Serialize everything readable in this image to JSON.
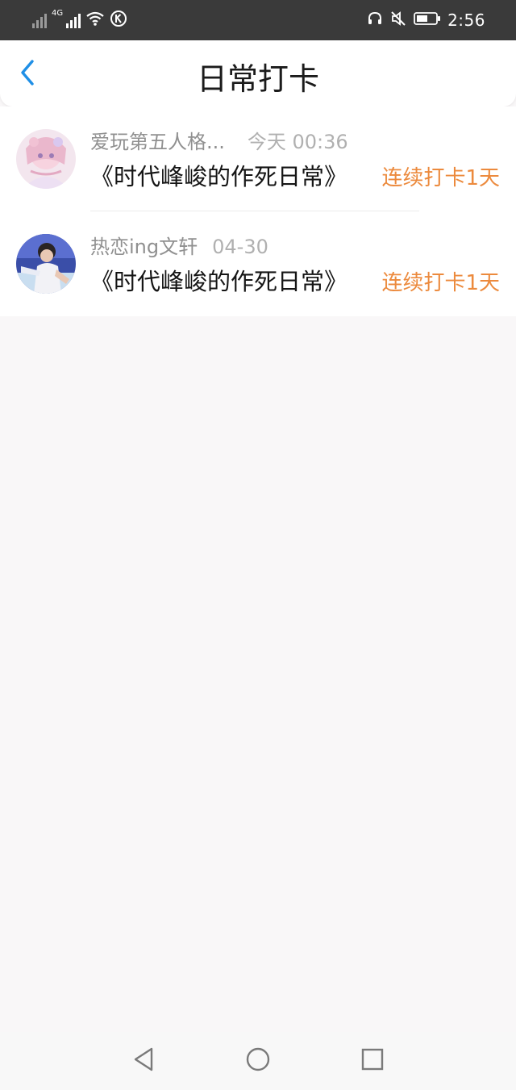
{
  "status_bar": {
    "time": "2:56",
    "network_label": "4G",
    "icons": [
      "signal-off-icon",
      "signal-4g-icon",
      "wifi-icon",
      "k-circle-icon",
      "headphones-icon",
      "mute-icon",
      "battery-icon"
    ]
  },
  "header": {
    "title": "日常打卡",
    "back_icon": "chevron-left-icon"
  },
  "list": [
    {
      "username": "爱玩第五人格...",
      "time": "今天 00:36",
      "title": "《时代峰峻的作死日常》",
      "streak": "连续打卡1天"
    },
    {
      "username": "热恋ing文轩",
      "time": "04-30",
      "title": "《时代峰峻的作死日常》",
      "streak": "连续打卡1天"
    }
  ],
  "nav": {
    "icons": [
      "back-triangle-icon",
      "home-circle-icon",
      "recents-square-icon"
    ]
  },
  "colors": {
    "accent_blue": "#1f8fe6",
    "streak_orange": "#ec8a3d",
    "status_bar": "#3a3a3a",
    "background": "#f9f7f8"
  }
}
